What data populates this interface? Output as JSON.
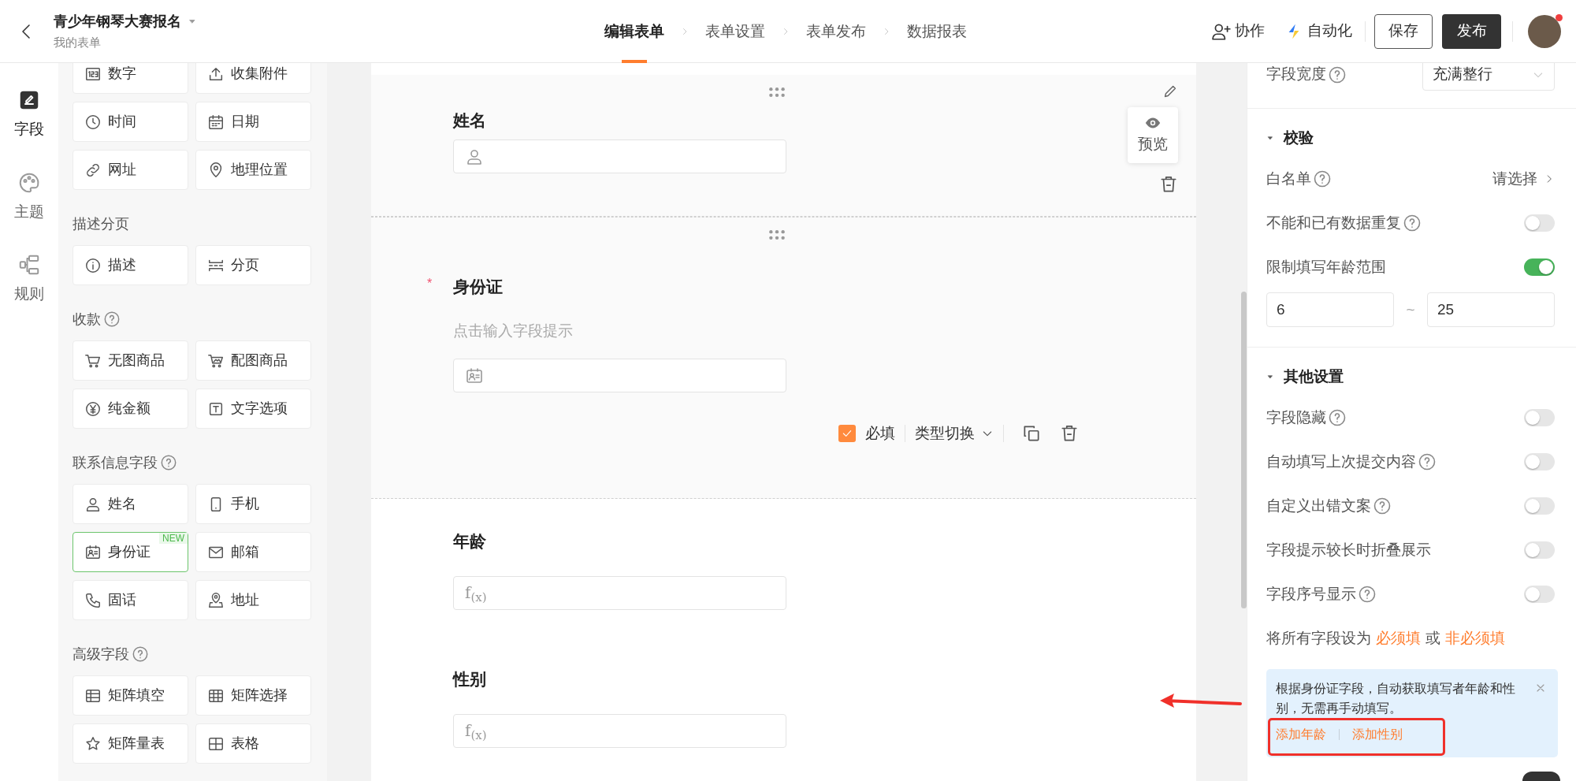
{
  "header": {
    "title": "青少年钢琴大赛报名",
    "subtitle": "我的表单",
    "steps": [
      {
        "label": "编辑表单",
        "selected": true
      },
      {
        "label": "表单设置",
        "selected": false
      },
      {
        "label": "表单发布",
        "selected": false
      },
      {
        "label": "数据报表",
        "selected": false
      }
    ],
    "collaborate": "协作",
    "automation": "自动化",
    "save": "保存",
    "publish": "发布",
    "notification_dot": true
  },
  "rail": [
    {
      "label": "字段",
      "selected": true
    },
    {
      "label": "主题",
      "selected": false
    },
    {
      "label": "规则",
      "selected": false
    }
  ],
  "palette": [
    {
      "items": [
        {
          "label": "数字"
        },
        {
          "label": "收集附件"
        },
        {
          "label": "时间"
        },
        {
          "label": "日期"
        },
        {
          "label": "网址"
        },
        {
          "label": "地理位置"
        }
      ]
    },
    {
      "heading": "描述分页",
      "help": false,
      "items": [
        {
          "label": "描述"
        },
        {
          "label": "分页"
        }
      ]
    },
    {
      "heading": "收款",
      "help": true,
      "items": [
        {
          "label": "无图商品"
        },
        {
          "label": "配图商品"
        },
        {
          "label": "纯金额"
        },
        {
          "label": "文字选项"
        }
      ]
    },
    {
      "heading": "联系信息字段",
      "help": true,
      "items": [
        {
          "label": "姓名"
        },
        {
          "label": "手机"
        },
        {
          "label": "身份证",
          "badge": "NEW"
        },
        {
          "label": "邮箱"
        },
        {
          "label": "固话"
        },
        {
          "label": "地址"
        }
      ]
    },
    {
      "heading": "高级字段",
      "help": true,
      "items": [
        {
          "label": "矩阵填空"
        },
        {
          "label": "矩阵选择"
        },
        {
          "label": "矩阵量表"
        },
        {
          "label": "表格"
        }
      ]
    }
  ],
  "form": {
    "fields": [
      {
        "label": "姓名",
        "kind": "name",
        "required": false,
        "selected": false,
        "hovered": true
      },
      {
        "label": "身份证",
        "kind": "id_card",
        "required": true,
        "hint": "点击输入字段提示",
        "selected": true,
        "hovered": false
      },
      {
        "label": "年龄",
        "kind": "formula",
        "formula": "f$_{(x)}$",
        "required": false,
        "selected": false,
        "hovered": false
      },
      {
        "label": "性别",
        "kind": "formula",
        "formula": "f$_{(x)}$",
        "required": false,
        "selected": false,
        "hovered": false
      }
    ],
    "required_mark": "*",
    "toolbar": {
      "required_label": "必填",
      "type_switch": "类型切换"
    },
    "preview": "预览"
  },
  "settings": {
    "width": {
      "label": "字段宽度",
      "help": true,
      "value": "充满整行"
    },
    "sections": [
      {
        "title": "校验",
        "expanded": true,
        "rows": [
          {
            "kind": "link",
            "label": "白名单",
            "help": true,
            "value": "请选择"
          },
          {
            "kind": "toggle",
            "label": "不能和已有数据重复",
            "help": true,
            "on": false
          },
          {
            "kind": "toggle",
            "label": "限制填写年龄范围",
            "help": false,
            "on": true
          },
          {
            "kind": "range",
            "min": "6",
            "separator": "~",
            "max": "25"
          }
        ]
      },
      {
        "title": "其他设置",
        "expanded": true,
        "rows": [
          {
            "kind": "toggle",
            "label": "字段隐藏",
            "help": true,
            "on": false
          },
          {
            "kind": "toggle",
            "label": "自动填写上次提交内容",
            "help": true,
            "on": false
          },
          {
            "kind": "toggle",
            "label": "自定义出错文案",
            "help": true,
            "on": false
          },
          {
            "kind": "toggle",
            "label": "字段提示较长时折叠展示",
            "help": false,
            "on": false
          },
          {
            "kind": "toggle",
            "label": "字段序号显示",
            "help": true,
            "on": false
          }
        ]
      }
    ],
    "bulk": {
      "prefix": "将所有字段设为",
      "required": "必须填",
      "or": "或",
      "optional": "非必须填"
    },
    "tip": {
      "text": "根据身份证字段，自动获取填写者年龄和性别，无需再手动填写。",
      "actions": [
        "添加年龄",
        "添加性别"
      ]
    }
  }
}
